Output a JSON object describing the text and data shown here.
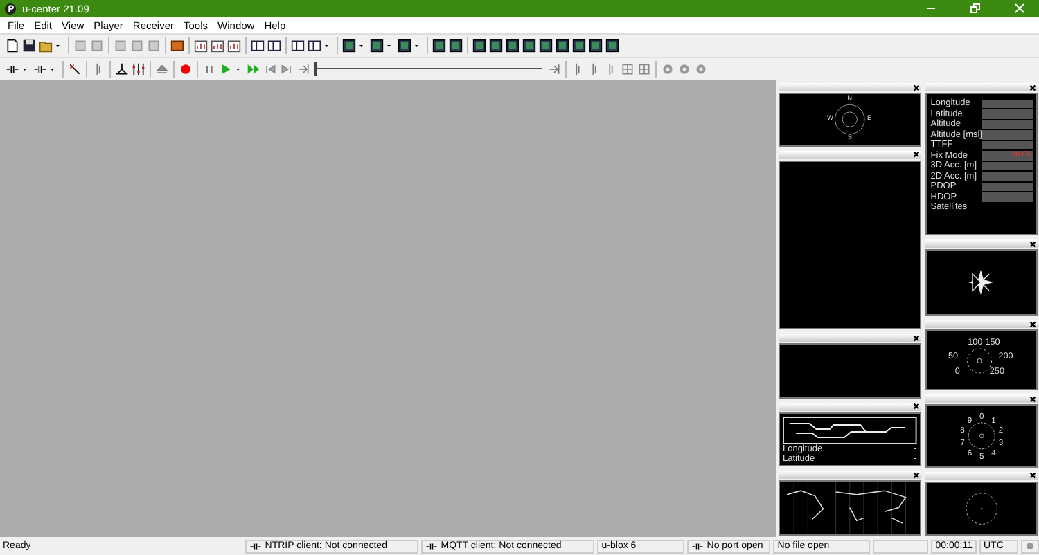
{
  "window": {
    "title": "u-center 21.09"
  },
  "menu": [
    "File",
    "Edit",
    "View",
    "Player",
    "Receiver",
    "Tools",
    "Window",
    "Help"
  ],
  "player": {
    "level": 0
  },
  "compass": {
    "labels": [
      "N",
      "E",
      "S",
      "W"
    ]
  },
  "data_view": {
    "fields": [
      {
        "label": "Longitude",
        "box": true
      },
      {
        "label": "Latitude",
        "box": true
      },
      {
        "label": "Altitude",
        "box": true
      },
      {
        "label": "Altitude [msl]",
        "box": true
      },
      {
        "label": "TTFF",
        "box": true
      },
      {
        "label": "Fix Mode",
        "box": true,
        "value": "No Fix"
      },
      {
        "label": "3D Acc. [m]",
        "box": true
      },
      {
        "label": "2D Acc. [m]",
        "box": true
      },
      {
        "label": "PDOP",
        "box": true
      },
      {
        "label": "HDOP",
        "box": true
      },
      {
        "label": "Satellites",
        "box": false
      }
    ]
  },
  "speed_gauge": {
    "labels": [
      "100",
      "150",
      "50",
      "200",
      "0",
      "250"
    ]
  },
  "clock_dial": {
    "labels": [
      "0",
      "1",
      "2",
      "3",
      "4",
      "5",
      "6",
      "7",
      "8",
      "9"
    ]
  },
  "map_view": {
    "fields": [
      {
        "label": "Longitude",
        "value": "-"
      },
      {
        "label": "Latitude",
        "value": "-"
      }
    ]
  },
  "status_bar": {
    "status": "Ready",
    "ntrip": "NTRIP client: Not connected",
    "mqtt": "MQTT client: Not connected",
    "receiver": "u-blox 6",
    "port": "No port open",
    "file": "No file open",
    "time": "00:00:11",
    "timezone": "UTC"
  }
}
